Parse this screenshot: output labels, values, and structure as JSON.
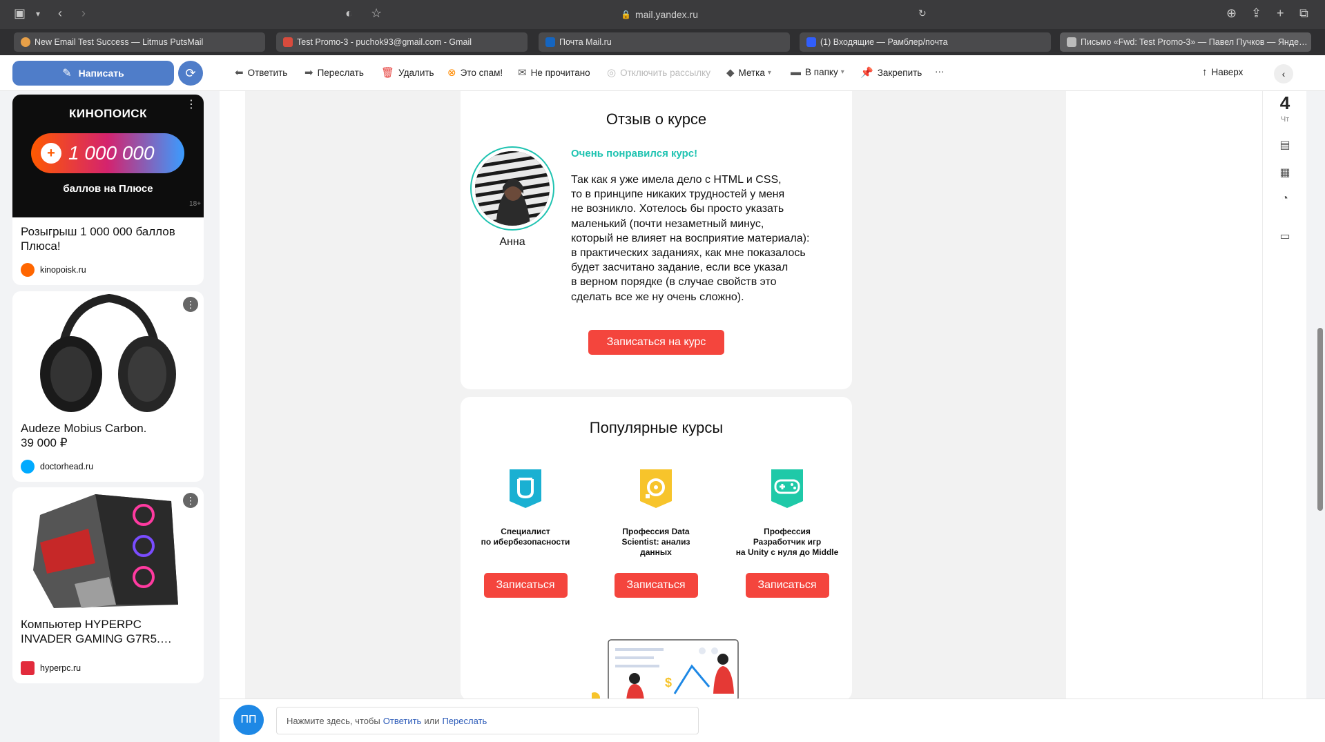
{
  "browser": {
    "url": "mail.yandex.ru",
    "tabs": [
      {
        "label": "New Email Test Success — Litmus PutsMail",
        "color": "#e8a048"
      },
      {
        "label": "Test Promo-3 - puchok93@gmail.com - Gmail",
        "color": "#d84b3d"
      },
      {
        "label": "Почта Mail.ru",
        "color": "#1565c0"
      },
      {
        "label": "(1) Входящие — Рамблер/почта",
        "color": "#315efb"
      },
      {
        "label": "Письмо «Fwd: Test Promo-3» — Павел Пучков — Янде…",
        "color": "#bbbbbb"
      }
    ]
  },
  "toolbar": {
    "compose_label": "Написать",
    "reply": "Ответить",
    "forward": "Переслать",
    "delete": "Удалить",
    "spam": "Это спам!",
    "unread": "Не прочитано",
    "unsubscribe": "Отключить рассылку",
    "label": "Метка",
    "folder": "В папку",
    "pin": "Закрепить",
    "more": "···",
    "top": "Наверх"
  },
  "ads": [
    {
      "banner_brand": "КИНОПОИСК",
      "banner_amount": "1 000 000",
      "banner_caption": "баллов на Плюсе",
      "banner_age": "18+",
      "title": "Розыгрыш 1 000 000 баллов Плюса!",
      "source": "kinopoisk.ru",
      "color": "#ff6600"
    },
    {
      "title": "Audeze Mobius Carbon.\n39 000 ₽",
      "source": "doctorhead.ru",
      "color": "#00aaff"
    },
    {
      "title": "Компьютер HYPERPC INVADER GAMING G7R5.…",
      "source": "hyperpc.ru",
      "color": "#e22b3c"
    }
  ],
  "review": {
    "title": "Отзыв о курсе",
    "name": "Анна",
    "lead": "Очень понравился курс!",
    "text": "Так как я уже имела дело с HTML и CSS,\nто в принципе никаких трудностей у меня\nне возникло. Хотелось бы просто указать\nмаленький (почти незаметный минус,\nкоторый не влияет на восприятие материала):\nв практических заданиях, как мне показалось\nбудет засчитано задание, если все указал\nв верном порядке (в случае свойств это\nсделать все же ну очень сложно).",
    "cta": "Записаться на курс"
  },
  "popular": {
    "title": "Популярные курсы",
    "courses": [
      {
        "name": "Специалист\nпо ибербезопасности",
        "button": "Записаться",
        "color": "#1ab0d2"
      },
      {
        "name": "Профессия Data\nScientist: анализ\nданных",
        "button": "Записаться",
        "color": "#f7c42b"
      },
      {
        "name": "Профессия\nРазработчик игр\nна Unity с нуля до Middle",
        "button": "Записаться",
        "color": "#1fc9a8"
      }
    ]
  },
  "rail": {
    "date": "4",
    "day": "Чт"
  },
  "reply": {
    "avatar": "ПП",
    "prefix": "Нажмите здесь, чтобы",
    "reply_link": "Ответить",
    "or": "или",
    "forward_link": "Переслать"
  },
  "colors": {
    "accent": "#4f7dc9",
    "cta": "#f4453d",
    "teal": "#1fc3b1"
  }
}
